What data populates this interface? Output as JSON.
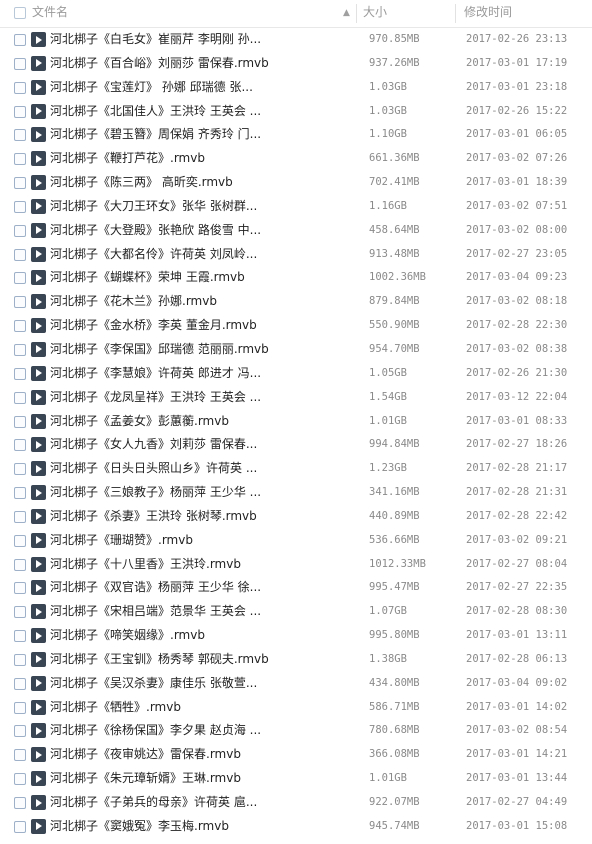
{
  "header": {
    "name_label": "文件名",
    "sort_icon": "▲",
    "size_label": "大小",
    "date_label": "修改时间"
  },
  "files": [
    {
      "name": "河北梆子《白毛女》崔丽芹 李明刚 孙...",
      "size": "970.85MB",
      "date": "2017-02-26 23:13"
    },
    {
      "name": "河北梆子《百合峪》刘丽莎 雷保春.rmvb",
      "size": "937.26MB",
      "date": "2017-03-01 17:19"
    },
    {
      "name": "河北梆子《宝莲灯》 孙娜 邱瑞德 张...",
      "size": "1.03GB",
      "date": "2017-03-01 23:18"
    },
    {
      "name": "河北梆子《北国佳人》王洪玲 王英会 ...",
      "size": "1.03GB",
      "date": "2017-02-26 15:22"
    },
    {
      "name": "河北梆子《碧玉簪》周保娟 齐秀玲 门...",
      "size": "1.10GB",
      "date": "2017-03-01 06:05"
    },
    {
      "name": "河北梆子《鞭打芦花》.rmvb",
      "size": "661.36MB",
      "date": "2017-03-02 07:26"
    },
    {
      "name": "河北梆子《陈三两》 高昕奕.rmvb",
      "size": "702.41MB",
      "date": "2017-03-01 18:39"
    },
    {
      "name": "河北梆子《大刀王环女》张华 张树群...",
      "size": "1.16GB",
      "date": "2017-03-02 07:51"
    },
    {
      "name": "河北梆子《大登殿》张艳欣 路俊雪 中...",
      "size": "458.64MB",
      "date": "2017-03-02 08:00"
    },
    {
      "name": "河北梆子《大都名伶》许荷英 刘凤岭...",
      "size": "913.48MB",
      "date": "2017-02-27 23:05"
    },
    {
      "name": "河北梆子《蝴蝶杯》荣坤 王霞.rmvb",
      "size": "1002.36MB",
      "date": "2017-03-04 09:23"
    },
    {
      "name": "河北梆子《花木兰》孙娜.rmvb",
      "size": "879.84MB",
      "date": "2017-03-02 08:18"
    },
    {
      "name": "河北梆子《金水桥》李英 董金月.rmvb",
      "size": "550.90MB",
      "date": "2017-02-28 22:30"
    },
    {
      "name": "河北梆子《李保国》邱瑞德 范丽丽.rmvb",
      "size": "954.70MB",
      "date": "2017-03-02 08:38"
    },
    {
      "name": "河北梆子《李慧娘》许荷英 郎进才 冯...",
      "size": "1.05GB",
      "date": "2017-02-26 21:30"
    },
    {
      "name": "河北梆子《龙凤呈祥》王洪玲 王英会 ...",
      "size": "1.54GB",
      "date": "2017-03-12 22:04"
    },
    {
      "name": "河北梆子《孟姜女》彭蕙蘅.rmvb",
      "size": "1.01GB",
      "date": "2017-03-01 08:33"
    },
    {
      "name": "河北梆子《女人九香》刘莉莎 雷保春...",
      "size": "994.84MB",
      "date": "2017-02-27 18:26"
    },
    {
      "name": "河北梆子《日头日头照山乡》许荷英 ...",
      "size": "1.23GB",
      "date": "2017-02-28 21:17"
    },
    {
      "name": "河北梆子《三娘教子》杨丽萍 王少华 ...",
      "size": "341.16MB",
      "date": "2017-02-28 21:31"
    },
    {
      "name": "河北梆子《杀妻》王洪玲 张树琴.rmvb",
      "size": "440.89MB",
      "date": "2017-02-28 22:42"
    },
    {
      "name": "河北梆子《珊瑚赞》.rmvb",
      "size": "536.66MB",
      "date": "2017-03-02 09:21"
    },
    {
      "name": "河北梆子《十八里香》王洪玲.rmvb",
      "size": "1012.33MB",
      "date": "2017-02-27 08:04"
    },
    {
      "name": "河北梆子《双官诰》杨丽萍 王少华 徐...",
      "size": "995.47MB",
      "date": "2017-02-27 22:35"
    },
    {
      "name": "河北梆子《宋相吕端》范景华 王英会 ...",
      "size": "1.07GB",
      "date": "2017-02-28 08:30"
    },
    {
      "name": "河北梆子《啼笑姻缘》.rmvb",
      "size": "995.80MB",
      "date": "2017-03-01 13:11"
    },
    {
      "name": "河北梆子《王宝钏》杨秀琴 郭砚夫.rmvb",
      "size": "1.38GB",
      "date": "2017-02-28 06:13"
    },
    {
      "name": "河北梆子《吴汉杀妻》康佳乐 张敬萱...",
      "size": "434.80MB",
      "date": "2017-03-04 09:02"
    },
    {
      "name": "河北梆子《牺牲》.rmvb",
      "size": "586.71MB",
      "date": "2017-03-01 14:02"
    },
    {
      "name": "河北梆子《徐杨保国》李夕果 赵贞海 ...",
      "size": "780.68MB",
      "date": "2017-03-02 08:54"
    },
    {
      "name": "河北梆子《夜审姚达》雷保春.rmvb",
      "size": "366.08MB",
      "date": "2017-03-01 14:21"
    },
    {
      "name": "河北梆子《朱元璋斩婿》王琳.rmvb",
      "size": "1.01GB",
      "date": "2017-03-01 13:44"
    },
    {
      "name": "河北梆子《子弟兵的母亲》许荷英 扈...",
      "size": "922.07MB",
      "date": "2017-02-27 04:49"
    },
    {
      "name": "河北梆子《窦娥冤》李玉梅.rmvb",
      "size": "945.74MB",
      "date": "2017-03-01 15:08"
    }
  ]
}
